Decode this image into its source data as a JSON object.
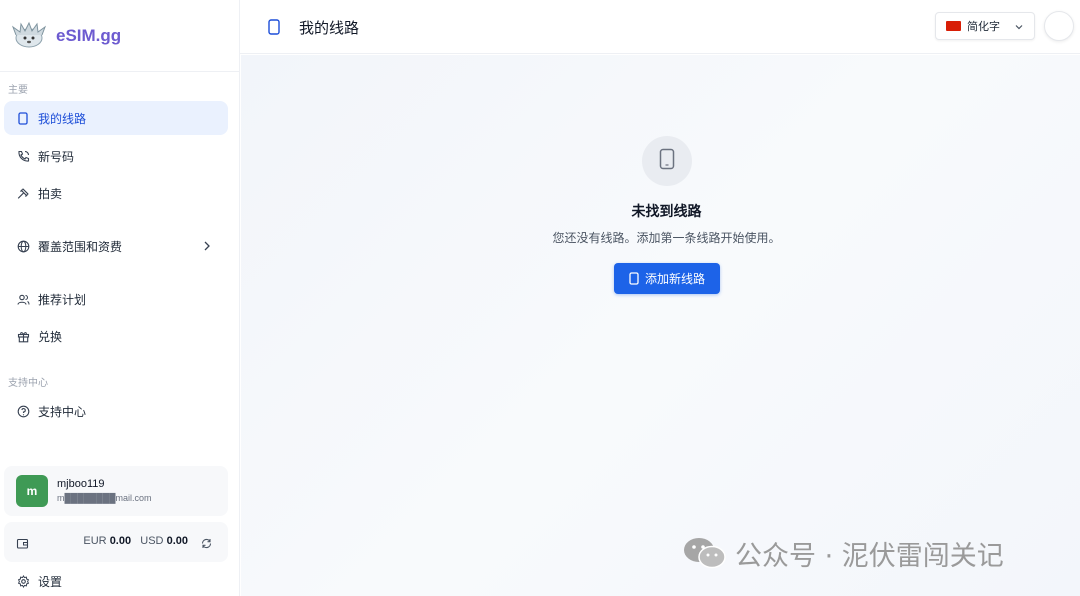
{
  "brand": {
    "name": "eSIM.gg"
  },
  "sidebar": {
    "section_main": "主要",
    "section_support": "支持中心",
    "items": [
      {
        "label": "我的线路",
        "icon": "phone-icon",
        "active": true
      },
      {
        "label": "新号码",
        "icon": "phone-call-icon"
      },
      {
        "label": "拍卖",
        "icon": "gavel-icon"
      },
      {
        "label": "覆盖范围和资费",
        "icon": "globe-icon"
      },
      {
        "label": "推荐计划",
        "icon": "users-icon"
      },
      {
        "label": "兑换",
        "icon": "gift-icon"
      },
      {
        "label": "支持中心",
        "icon": "help-circle-icon"
      },
      {
        "label": "设置",
        "icon": "gear-icon"
      }
    ]
  },
  "user": {
    "initial": "m",
    "name": "mjboo119",
    "email": "m████████mail.com",
    "avatar_color": "#3f9a55"
  },
  "balance": {
    "eur_label": "EUR",
    "eur_value": "0.00",
    "usd_label": "USD",
    "usd_value": "0.00"
  },
  "header": {
    "title": "我的线路",
    "language": "简化字"
  },
  "empty_state": {
    "title": "未找到线路",
    "description": "您还没有线路。添加第一条线路开始使用。",
    "button_label": "添加新线路"
  },
  "watermark": {
    "text": "公众号 · 泥伏雷闯关记"
  },
  "colors": {
    "accent": "#1d63e8",
    "brand": "#6d5bd0",
    "active_bg": "#eaf1fe"
  }
}
